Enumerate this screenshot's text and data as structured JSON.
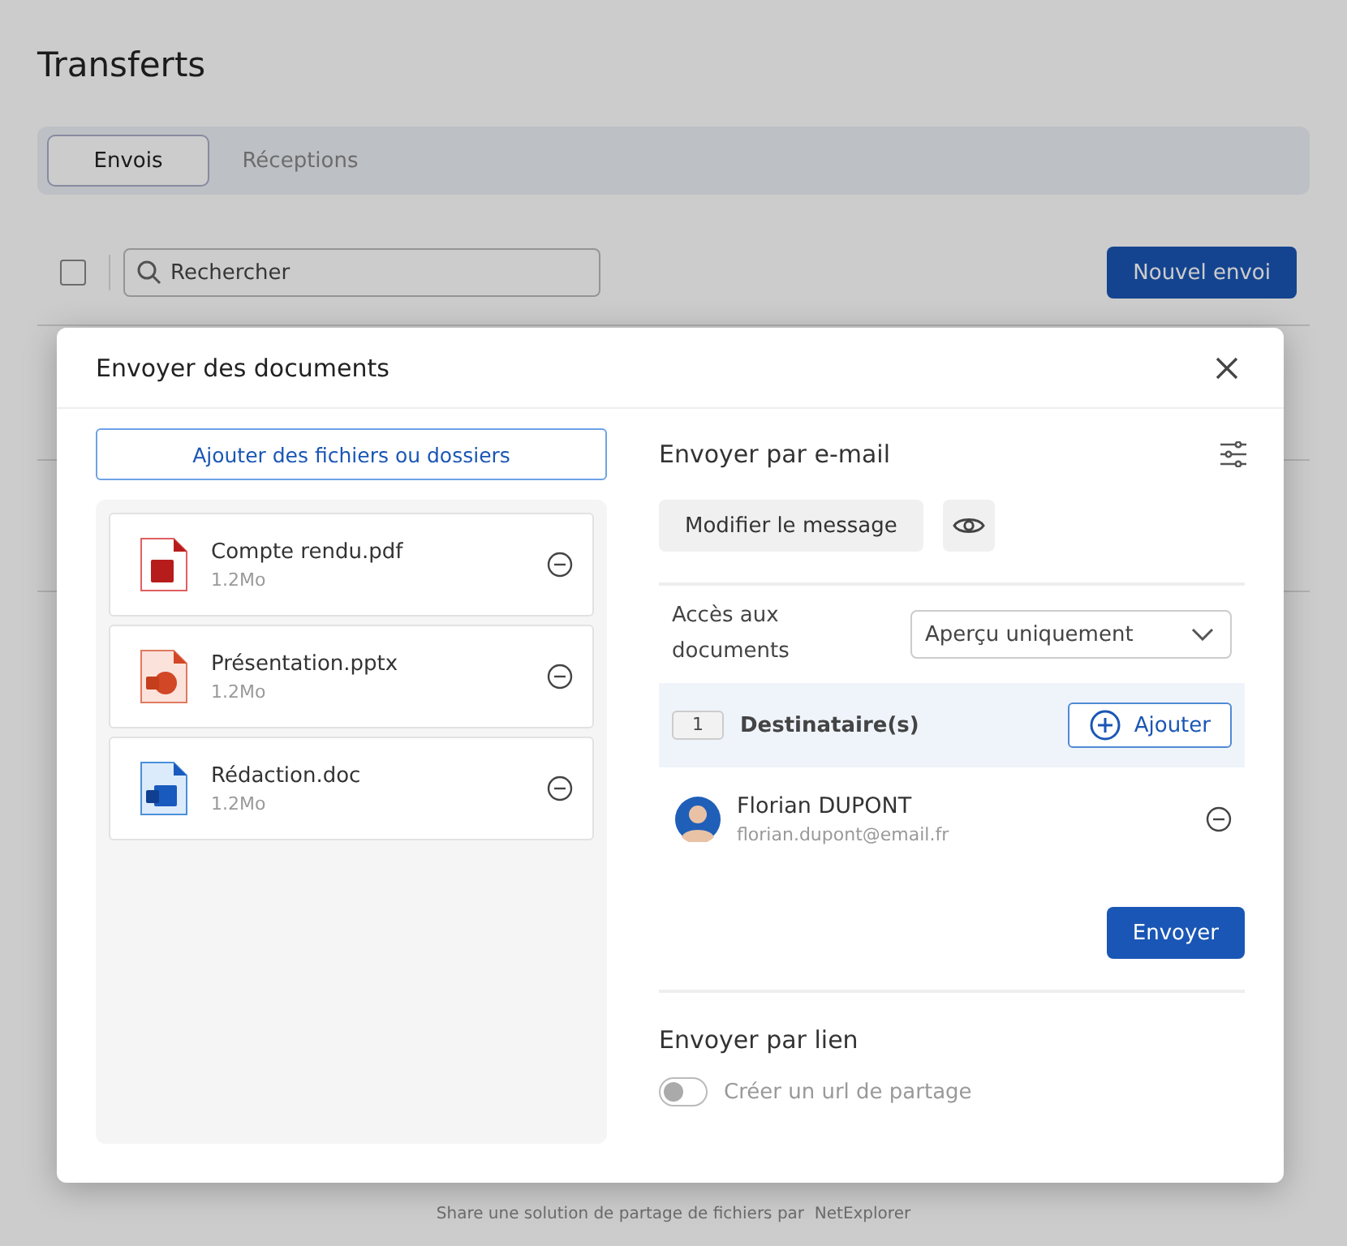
{
  "page": {
    "title": "Transferts"
  },
  "tabs": [
    {
      "label": "Envois",
      "selected": true
    },
    {
      "label": "Réceptions",
      "selected": false
    }
  ],
  "toolbar": {
    "select_all": {
      "checked": false
    },
    "search": {
      "placeholder": "Rechercher"
    },
    "new_button": "Nouvel envoi"
  },
  "dialog": {
    "title": "Envoyer des documents",
    "add_files_button": "Ajouter des fichiers ou dossiers",
    "files": [
      {
        "kind": "pdf",
        "name": "Compte rendu.pdf",
        "size": "1.2Mo"
      },
      {
        "kind": "pptx",
        "name": "Présentation.pptx",
        "size": "1.2Mo"
      },
      {
        "kind": "doc",
        "name": "Rédaction.doc",
        "size": "1.2Mo"
      }
    ],
    "email": {
      "title": "Envoyer par e-mail",
      "edit_message_button": "Modifier le message",
      "access_label": "Accès aux documents",
      "access_value": "Aperçu uniquement",
      "recipients_count": "1",
      "recipients_label": "Destinataire(s)",
      "add_button": "Ajouter",
      "recipients": [
        {
          "name": "Florian DUPONT",
          "email": "florian.dupont@email.fr"
        }
      ],
      "send_button": "Envoyer"
    },
    "link": {
      "title": "Envoyer par lien",
      "toggle_label": "Créer un url de partage",
      "on": false
    }
  },
  "footer": "Share une solution de partage de fichiers par  NetExplorer"
}
